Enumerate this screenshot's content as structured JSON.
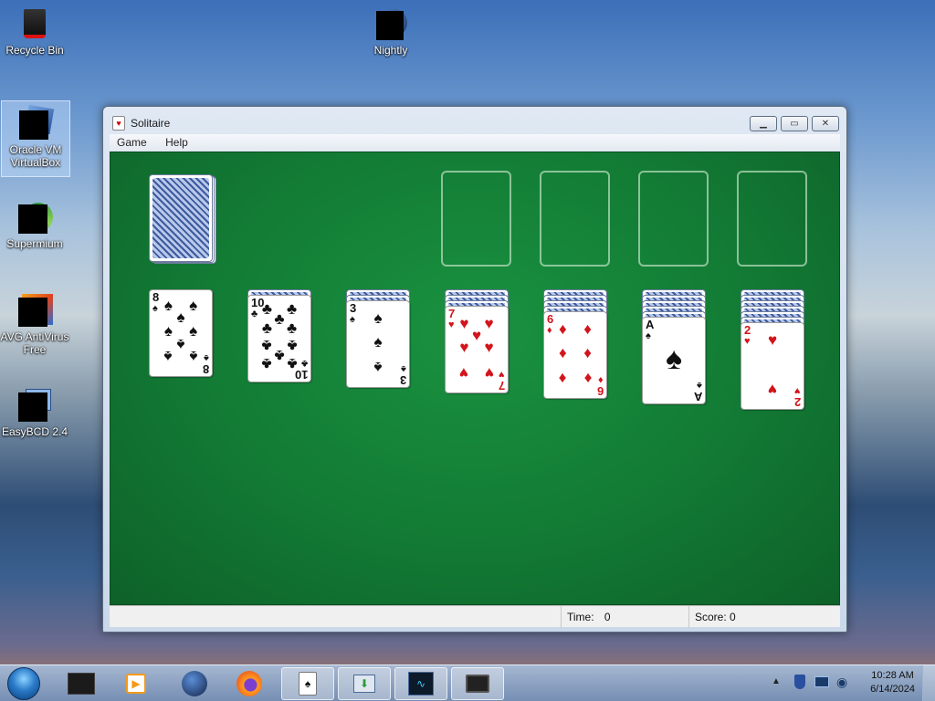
{
  "desktop": {
    "icons": [
      {
        "label": "Recycle Bin"
      },
      {
        "label": "Nightly"
      },
      {
        "label": "Oracle VM VirtualBox"
      },
      {
        "label": "Supermium"
      },
      {
        "label": "AVG AntiVirus Free"
      },
      {
        "label": "EasyBCD 2.4"
      }
    ]
  },
  "window": {
    "title": "Solitaire",
    "menu": [
      "Game",
      "Help"
    ],
    "status": {
      "time_label": "Time:",
      "time_value": "0",
      "score_label": "Score:",
      "score_value": "0"
    }
  },
  "game": {
    "tableau": [
      {
        "face_down": 0,
        "rank": "8",
        "suit": "♠",
        "color": "black"
      },
      {
        "face_down": 1,
        "rank": "10",
        "suit": "♣",
        "color": "black"
      },
      {
        "face_down": 2,
        "rank": "3",
        "suit": "♠",
        "color": "black"
      },
      {
        "face_down": 3,
        "rank": "7",
        "suit": "♥",
        "color": "red"
      },
      {
        "face_down": 4,
        "rank": "6",
        "suit": "♦",
        "color": "red"
      },
      {
        "face_down": 5,
        "rank": "A",
        "suit": "♠",
        "color": "black"
      },
      {
        "face_down": 6,
        "rank": "2",
        "suit": "♥",
        "color": "red"
      }
    ]
  },
  "taskbar": {
    "items": [
      "folder",
      "media-player",
      "nightly",
      "firefox",
      "solitaire",
      "file-manager",
      "monitor",
      "display"
    ],
    "clock_time": "10:28 AM",
    "clock_date": "6/14/2024"
  }
}
